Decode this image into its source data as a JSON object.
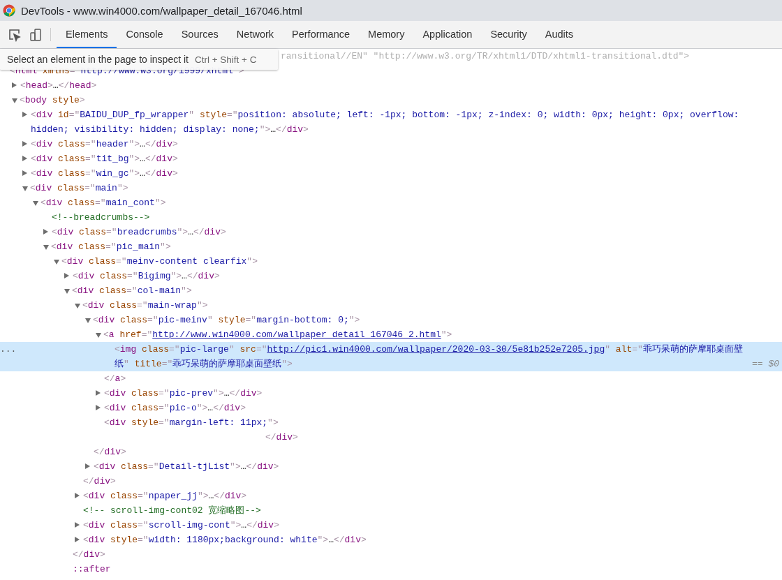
{
  "window": {
    "title": "DevTools - www.win4000.com/wallpaper_detail_167046.html"
  },
  "tabs": [
    {
      "label": "Elements",
      "selected": true
    },
    {
      "label": "Console",
      "selected": false
    },
    {
      "label": "Sources",
      "selected": false
    },
    {
      "label": "Network",
      "selected": false
    },
    {
      "label": "Performance",
      "selected": false
    },
    {
      "label": "Memory",
      "selected": false
    },
    {
      "label": "Application",
      "selected": false
    },
    {
      "label": "Security",
      "selected": false
    },
    {
      "label": "Audits",
      "selected": false
    }
  ],
  "tooltip": {
    "text": "Select an element in the page to inspect it",
    "shortcut": "Ctrl + Shift + C"
  },
  "elements_tree": {
    "doctype": "ransitional//EN\" \"http://www.w3.org/TR/xhtml1/DTD/xhtml1-transitional.dtd\">",
    "nodes": [
      {
        "kind": "element",
        "line": "<html xmlns=\"http://www.w3.org/1999/xhtml\">",
        "selected": false,
        "children": [
          {
            "kind": "element",
            "line": "<head>…</head>",
            "expanded": false,
            "selected": false
          },
          {
            "kind": "element",
            "line": "<body style>",
            "expanded": true,
            "selected": false,
            "children": [
              {
                "kind": "element",
                "line": "<div id=\"BAIDU_DUP_fp_wrapper\" style=\"position: absolute; left: -1px; bottom: -1px; z-index: 0; width: 0px; height: 0px; overflow: hidden; visibility: hidden; display: none;\">…</div>",
                "expanded": false,
                "selected": false
              },
              {
                "kind": "element",
                "line": "<div class=\"header\">…</div>",
                "expanded": false,
                "selected": false
              },
              {
                "kind": "element",
                "line": "<div class=\"tit_bg\">…</div>",
                "expanded": false,
                "selected": false
              },
              {
                "kind": "element",
                "line": "<div class=\"win_gc\">…</div>",
                "expanded": false,
                "selected": false
              },
              {
                "kind": "element",
                "line": "<div class=\"main\">",
                "expanded": true,
                "selected": false,
                "children": [
                  {
                    "kind": "element",
                    "line": "<div class=\"main_cont\">",
                    "expanded": true,
                    "selected": false,
                    "children": [
                      {
                        "kind": "comment",
                        "line": "<!--breadcrumbs-->",
                        "selected": false
                      },
                      {
                        "kind": "element",
                        "line": "<div class=\"breadcrumbs\">…</div>",
                        "expanded": false,
                        "selected": false
                      },
                      {
                        "kind": "element",
                        "line": "<div class=\"pic_main\">",
                        "expanded": true,
                        "selected": false,
                        "children": [
                          {
                            "kind": "element",
                            "line": "<div class=\"meinv-content clearfix\">",
                            "expanded": true,
                            "selected": false,
                            "children": [
                              {
                                "kind": "element",
                                "line": "<div class=\"Bigimg\">…</div>",
                                "expanded": false,
                                "selected": false
                              },
                              {
                                "kind": "element",
                                "line": "<div class=\"col-main\">",
                                "expanded": true,
                                "selected": false,
                                "close": "</div>",
                                "children": [
                                  {
                                    "kind": "element",
                                    "line": "<div class=\"main-wrap\">",
                                    "expanded": true,
                                    "selected": false,
                                    "close": "</div>",
                                    "children": [
                                      {
                                        "kind": "element",
                                        "line": "<div class=\"pic-meinv\" style=\"margin-bottom: 0;\">",
                                        "expanded": true,
                                        "selected": false,
                                        "close": "</div>",
                                        "children": [
                                          {
                                            "kind": "element",
                                            "line": "<a href=\"http://www.win4000.com/wallpaper_detail_167046_2.html\">",
                                            "link_flags": [
                                              true
                                            ],
                                            "expanded": true,
                                            "selected": false,
                                            "close": "</a>",
                                            "children": [
                                              {
                                                "kind": "element",
                                                "line": "<img class=\"pic-large\" src=\"http://pic1.win4000.com/wallpaper/2020-03-30/5e81b252e7205.jpg\" alt=\"乖巧呆萌的萨摩耶桌面壁纸\" title=\"乖巧呆萌的萨摩耶桌面壁纸\">",
                                                "link_flags": [
                                                  false,
                                                  true,
                                                  false,
                                                  false
                                                ],
                                                "selected": true,
                                                "gutter": "...",
                                                "suffix": "== $0"
                                              }
                                            ]
                                          },
                                          {
                                            "kind": "element",
                                            "line": "<div class=\"pic-prev\">…</div>",
                                            "expanded": false,
                                            "selected": false
                                          },
                                          {
                                            "kind": "element",
                                            "line": "<div class=\"pic-o\">…</div>",
                                            "expanded": false,
                                            "selected": false
                                          },
                                          {
                                            "kind": "element",
                                            "line": "<div style=\"margin-left: 11px;\">",
                                            "selected": false,
                                            "close": "</div>"
                                          }
                                        ]
                                      },
                                      {
                                        "kind": "element",
                                        "line": "<div class=\"Detail-tjList\">…</div>",
                                        "expanded": false,
                                        "selected": false
                                      }
                                    ]
                                  },
                                  {
                                    "kind": "element",
                                    "line": "<div class=\"npaper_jj\">…</div>",
                                    "expanded": false,
                                    "selected": false
                                  },
                                  {
                                    "kind": "comment",
                                    "line": "<!-- scroll-img-cont02 宽缩略图-->",
                                    "selected": false
                                  },
                                  {
                                    "kind": "element",
                                    "line": "<div class=\"scroll-img-cont\">…</div>",
                                    "expanded": false,
                                    "selected": false
                                  },
                                  {
                                    "kind": "element",
                                    "line": "<div style=\"width: 1180px;background: white\">…</div>",
                                    "expanded": false,
                                    "selected": false
                                  }
                                ]
                              },
                              {
                                "kind": "pseudo",
                                "line": "::after",
                                "selected": false
                              }
                            ]
                          }
                        ]
                      }
                    ]
                  }
                ]
              }
            ]
          }
        ]
      }
    ]
  }
}
